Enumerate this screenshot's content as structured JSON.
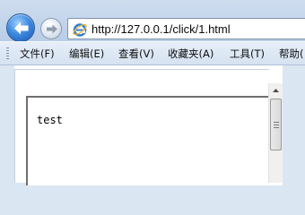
{
  "address_bar": {
    "url": "http://127.0.0.1/click/1.html"
  },
  "menu": {
    "items": [
      {
        "label": "文件(F)"
      },
      {
        "label": "编辑(E)"
      },
      {
        "label": "查看(V)"
      },
      {
        "label": "收藏夹(A)"
      },
      {
        "label": "工具(T)"
      },
      {
        "label": "帮助("
      }
    ]
  },
  "content": {
    "textarea_value": "test"
  },
  "icons": {
    "back": "back-arrow-icon",
    "forward": "forward-arrow-icon",
    "page": "internet-explorer-icon",
    "scroll_up": "triangle-up-icon"
  },
  "colors": {
    "chrome": "#dbe6f3",
    "back_button": "#3f8ae0"
  }
}
